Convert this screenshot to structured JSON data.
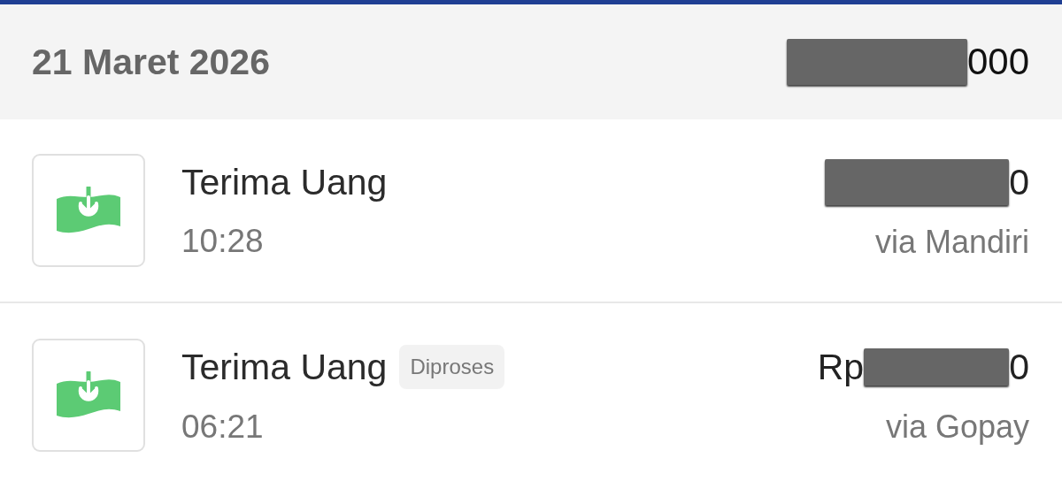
{
  "day_header": {
    "date": "21 Maret 2026",
    "total": {
      "visible_end": "000"
    }
  },
  "transactions": [
    {
      "title": "Terima Uang",
      "time": "10:28",
      "amount": {
        "visible_end": "0"
      },
      "channel": "via Mandiri"
    },
    {
      "title": "Terima Uang",
      "status": "Diproses",
      "time": "06:21",
      "amount": {
        "visible_start": "Rp",
        "visible_end": "0"
      },
      "channel": "via Gopay"
    }
  ]
}
